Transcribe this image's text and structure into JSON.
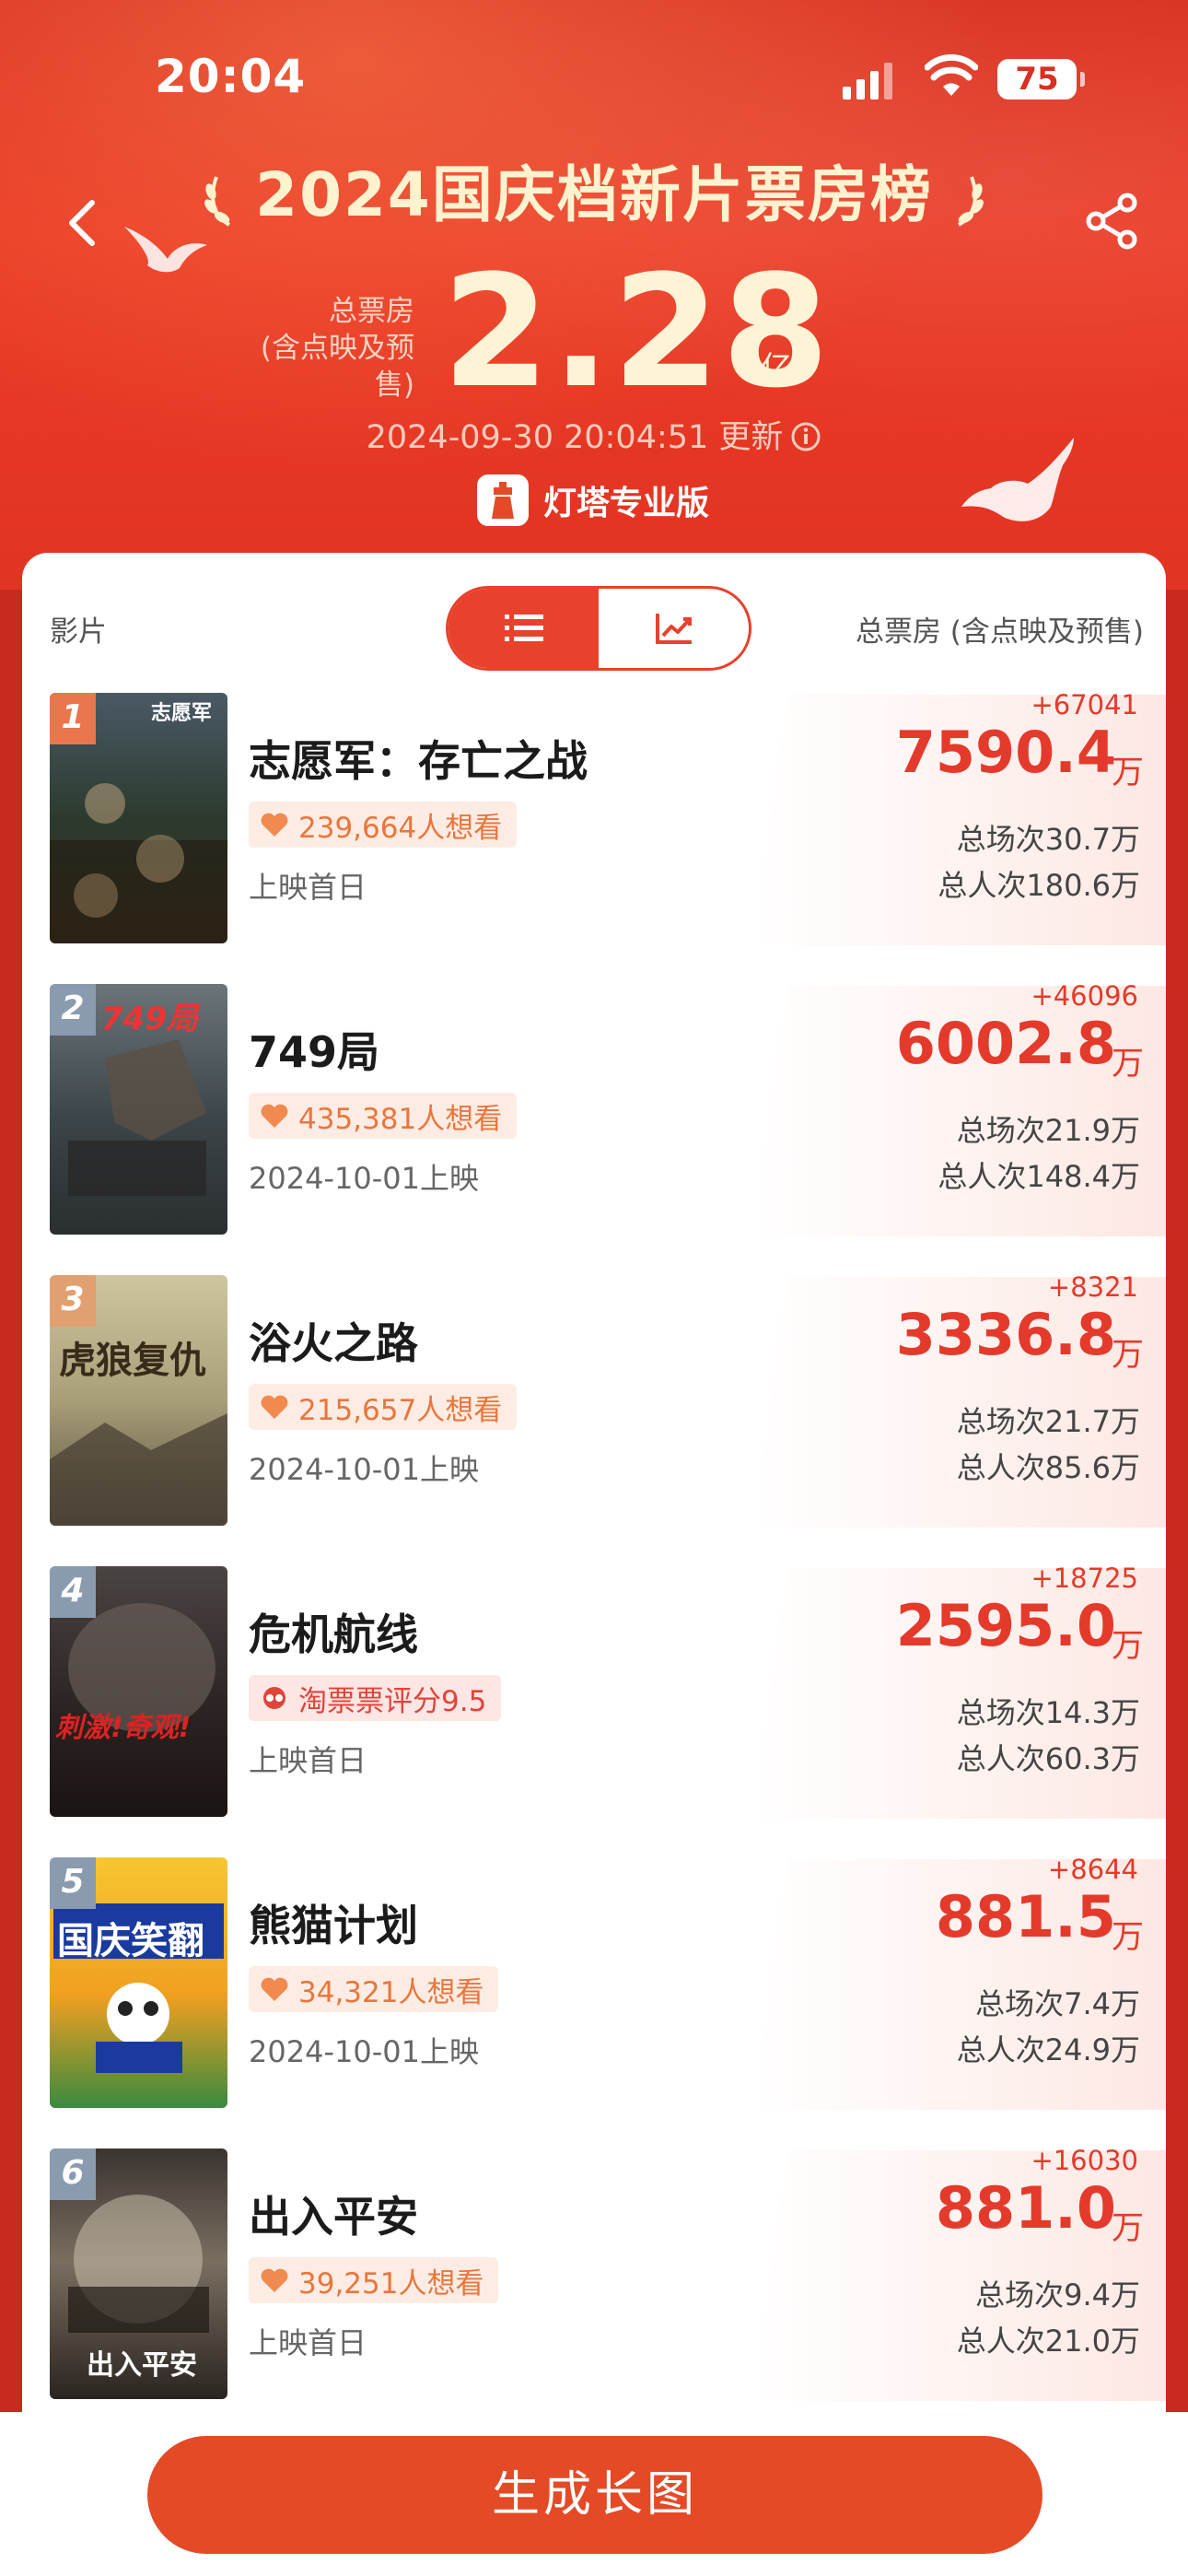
{
  "status": {
    "time": "20:04",
    "battery": "75"
  },
  "header": {
    "title": "2024国庆档新片票房榜",
    "total_label_1": "总票房",
    "total_label_2": "(含点映及预售)",
    "total_value": "2.28",
    "total_unit": "亿",
    "update_text": "2024-09-30 20:04:51 更新",
    "brand": "灯塔专业版"
  },
  "table": {
    "left_header": "影片",
    "right_header": "总票房 (含点映及预售)",
    "view_mode": "list"
  },
  "movies": [
    {
      "rank": "1",
      "name": "志愿军：存亡之战",
      "badge": "239,664人想看",
      "badge_type": "want",
      "release": "上映首日",
      "delta": "+67041",
      "box_office": "7590.4",
      "unit": "万",
      "shows": "总场次30.7万",
      "admissions": "总人次180.6万",
      "poster_text": "志愿军"
    },
    {
      "rank": "2",
      "name": "749局",
      "badge": "435,381人想看",
      "badge_type": "want",
      "release": "2024-10-01上映",
      "delta": "+46096",
      "box_office": "6002.8",
      "unit": "万",
      "shows": "总场次21.9万",
      "admissions": "总人次148.4万",
      "poster_text": "749局"
    },
    {
      "rank": "3",
      "name": "浴火之路",
      "badge": "215,657人想看",
      "badge_type": "want",
      "release": "2024-10-01上映",
      "delta": "+8321",
      "box_office": "3336.8",
      "unit": "万",
      "shows": "总场次21.7万",
      "admissions": "总人次85.6万",
      "poster_text": "虎狼复仇"
    },
    {
      "rank": "4",
      "name": "危机航线",
      "badge": "淘票票评分9.5",
      "badge_type": "rating",
      "release": "上映首日",
      "delta": "+18725",
      "box_office": "2595.0",
      "unit": "万",
      "shows": "总场次14.3万",
      "admissions": "总人次60.3万",
      "poster_text": "刺激!奇观!"
    },
    {
      "rank": "5",
      "name": "熊猫计划",
      "badge": "34,321人想看",
      "badge_type": "want",
      "release": "2024-10-01上映",
      "delta": "+8644",
      "box_office": "881.5",
      "unit": "万",
      "shows": "总场次7.4万",
      "admissions": "总人次24.9万",
      "poster_text": "国庆笑翻"
    },
    {
      "rank": "6",
      "name": "出入平安",
      "badge": "39,251人想看",
      "badge_type": "want",
      "release": "上映首日",
      "delta": "+16030",
      "box_office": "881.0",
      "unit": "万",
      "shows": "总场次9.4万",
      "admissions": "总人次21.0万",
      "poster_text": "出入平安"
    }
  ],
  "bottom": {
    "button": "生成长图"
  },
  "colors": {
    "accent": "#e8412c",
    "header_bg": "#e23423",
    "want_text": "#e9763d"
  }
}
